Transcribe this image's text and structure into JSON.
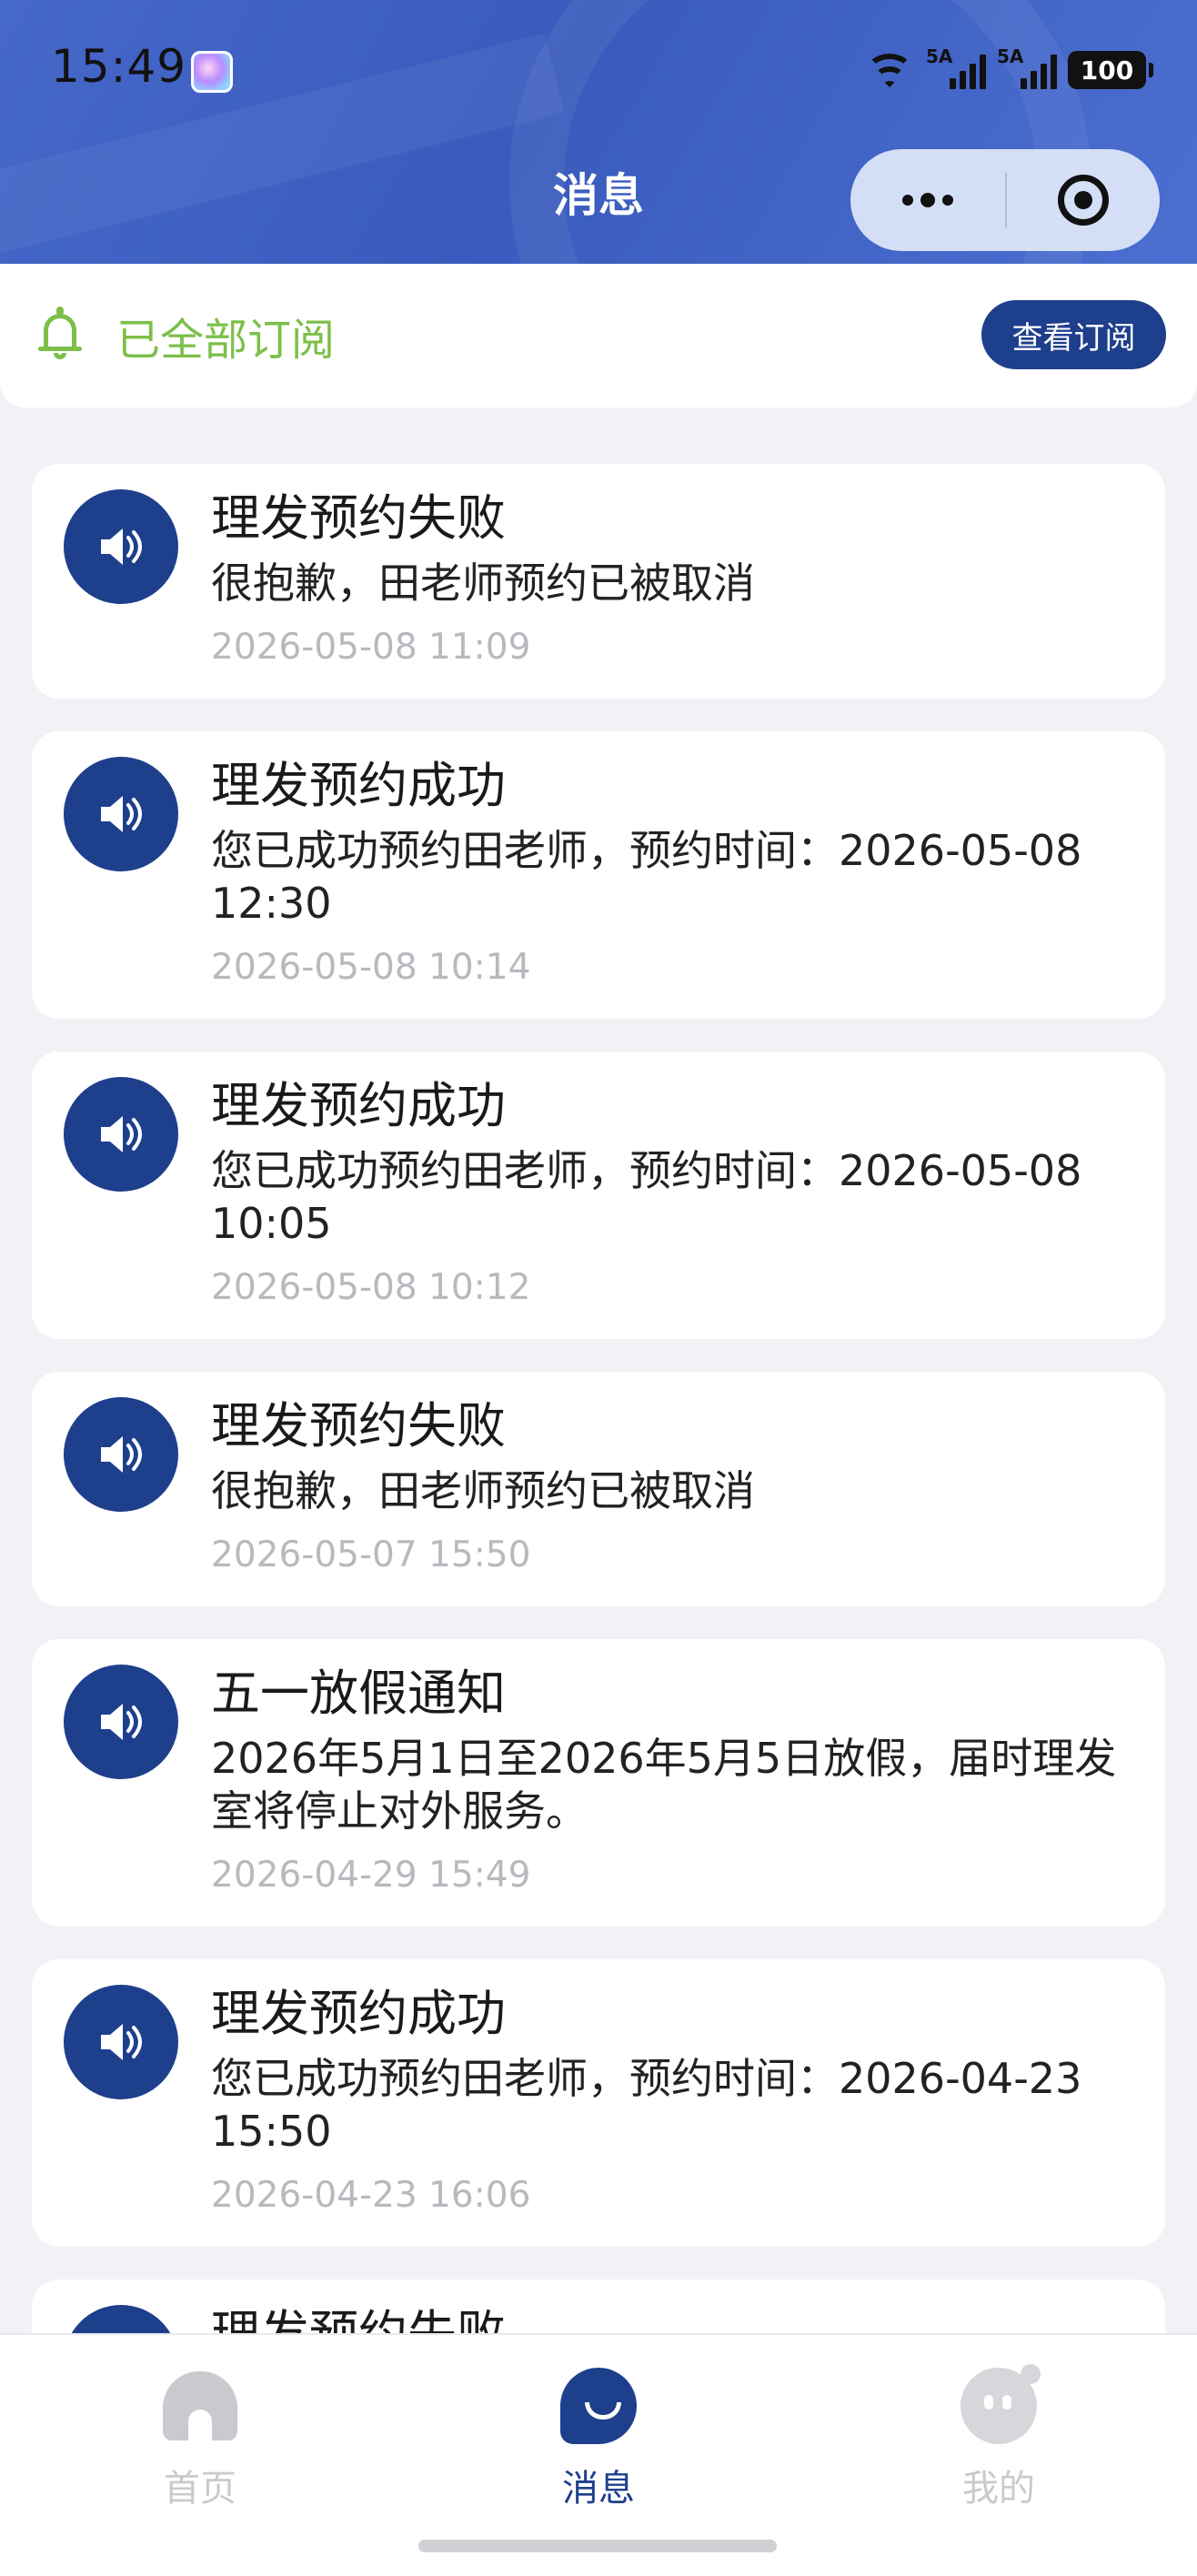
{
  "status_bar": {
    "time": "15:49",
    "signal_1_label": "5A",
    "signal_2_label": "5A",
    "battery": "100"
  },
  "header": {
    "title": "消息",
    "more_icon": "more-dots-icon",
    "close_icon": "target-icon"
  },
  "subscription": {
    "status_text": "已全部订阅",
    "button_label": "查看订阅",
    "icon": "bell-icon",
    "accent_color": "#7cbf4a"
  },
  "messages": [
    {
      "title": "理发预约失败",
      "content": "很抱歉，田老师预约已被取消",
      "time": "2026-05-08 11:09"
    },
    {
      "title": "理发预约成功",
      "content": "您已成功预约田老师，预约时间：2026-05-08 12:30",
      "time": "2026-05-08 10:14"
    },
    {
      "title": "理发预约成功",
      "content": "您已成功预约田老师，预约时间：2026-05-08 10:05",
      "time": "2026-05-08 10:12"
    },
    {
      "title": "理发预约失败",
      "content": "很抱歉，田老师预约已被取消",
      "time": "2026-05-07 15:50"
    },
    {
      "title": "五一放假通知",
      "content": "2026年5月1日至2026年5月5日放假，届时理发室将停止对外服务。",
      "time": "2026-04-29 15:49"
    },
    {
      "title": "理发预约成功",
      "content": "您已成功预约田老师，预约时间：2026-04-23 15:50",
      "time": "2026-04-23 16:06"
    },
    {
      "title": "理发预约失败",
      "content": "",
      "time": ""
    }
  ],
  "tabbar": {
    "home_label": "首页",
    "messages_label": "消息",
    "mine_label": "我的",
    "active_color": "#1e3f8c",
    "inactive_color": "#c9cacd"
  },
  "colors": {
    "brand": "#1e3f8c",
    "header_blue": "#4668c9",
    "background": "#f1f2f5"
  }
}
